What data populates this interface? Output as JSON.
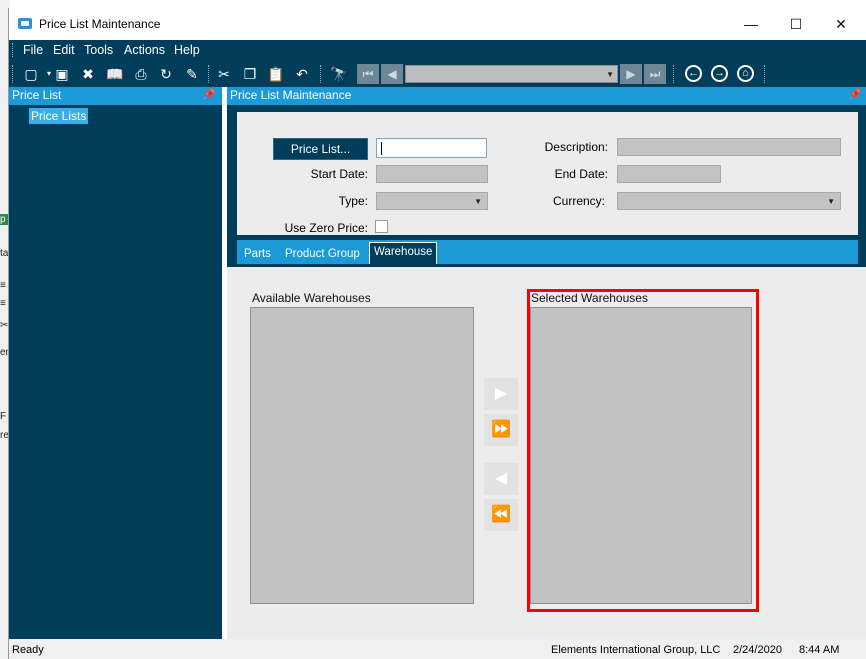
{
  "background": {
    "fragments": [
      "p",
      "ta",
      "≡",
      "≡",
      "✂",
      "en",
      "F",
      "re"
    ]
  },
  "window": {
    "title": "Price List Maintenance",
    "minimize_glyph": "—",
    "maximize_glyph": "☐",
    "close_glyph": "✕"
  },
  "menu": {
    "items": [
      "File",
      "Edit",
      "Tools",
      "Actions",
      "Help"
    ]
  },
  "toolbar": {
    "icons": [
      {
        "name": "new-icon",
        "glyph": "▢"
      },
      {
        "name": "save-icon",
        "glyph": "▣"
      },
      {
        "name": "delete-icon",
        "glyph": "✖"
      },
      {
        "name": "book-icon",
        "glyph": "📖"
      },
      {
        "name": "attach-icon",
        "glyph": "⎙"
      },
      {
        "name": "refresh-icon",
        "glyph": "↻"
      },
      {
        "name": "clear-icon",
        "glyph": "✎"
      },
      {
        "name": "cut-icon",
        "glyph": "✂"
      },
      {
        "name": "copy-icon",
        "glyph": "❐"
      },
      {
        "name": "paste-icon",
        "glyph": "📋"
      },
      {
        "name": "undo-icon",
        "glyph": "↶"
      },
      {
        "name": "search-icon",
        "glyph": "🔭"
      }
    ],
    "nav_first": "⏮",
    "nav_prev": "◀",
    "nav_next": "▶",
    "nav_last": "⏭",
    "nav_combo_value": "",
    "back_glyph": "←",
    "forward_glyph": "→",
    "home_glyph": "⌂"
  },
  "left_panel": {
    "title": "Price List",
    "pin": "📌",
    "tree_item": "Price Lists"
  },
  "right_panel": {
    "title": "Price List Maintenance",
    "pin": "📌"
  },
  "form": {
    "pricelist_button": "Price List...",
    "pricelist_value": "",
    "start_date_label": "Start Date:",
    "start_date_value": "",
    "type_label": "Type:",
    "type_value": "",
    "use_zero_price_label": "Use Zero Price:",
    "description_label": "Description:",
    "description_value": "",
    "end_date_label": "End Date:",
    "end_date_value": "",
    "currency_label": "Currency:",
    "currency_value": ""
  },
  "tabs": {
    "parts": "Parts",
    "product_group": "Product Group",
    "warehouse": "Warehouse"
  },
  "warehouse": {
    "available_label": "Available Warehouses",
    "selected_label": "Selected Warehouses",
    "move_right": "▶",
    "move_all_right": "⏩",
    "move_left": "◀",
    "move_all_left": "⏪"
  },
  "status": {
    "text": "Ready",
    "company": "Elements International Group, LLC",
    "date": "2/24/2020",
    "time": "8:44 AM"
  },
  "colors": {
    "dark": "#003d5b",
    "accent": "#1b9ad7",
    "highlight": "#ff0000"
  }
}
